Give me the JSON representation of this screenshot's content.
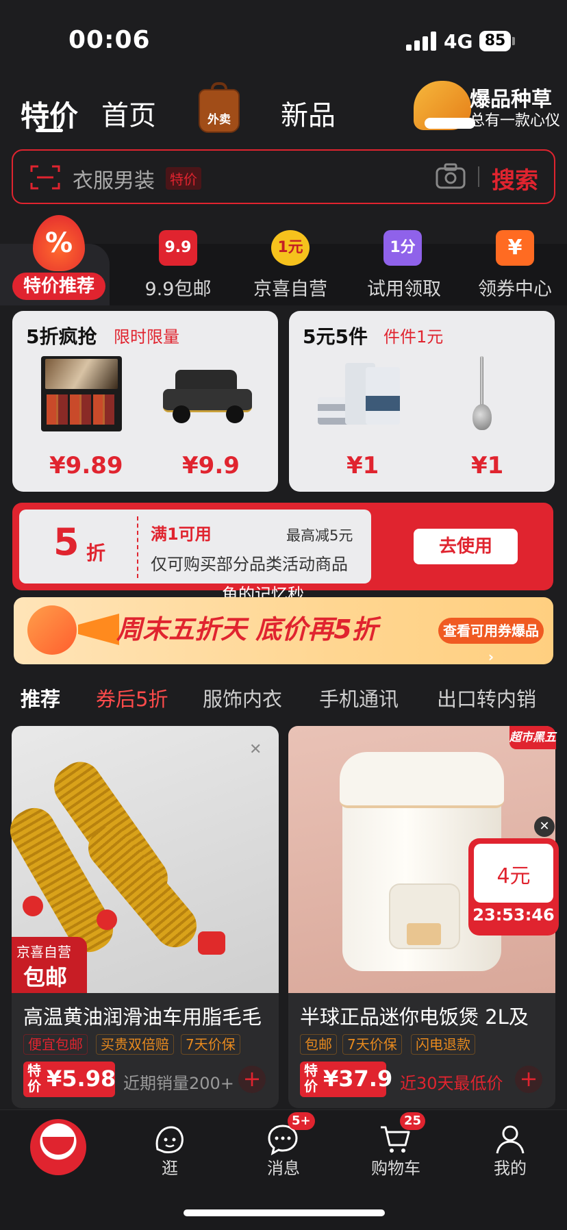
{
  "status_bar": {
    "time": "00:06",
    "network": "4G",
    "battery": "85"
  },
  "top_nav": {
    "tabs": [
      "特价",
      "首页",
      "新品"
    ],
    "takeout_label": "外卖",
    "promo_title": "爆品种草",
    "promo_subtitle": "总有一款心仪"
  },
  "search": {
    "placeholder": "衣服男装",
    "tag": "特价",
    "button": "搜索"
  },
  "categories": [
    {
      "label": "特价推荐",
      "icon": "flame-percent-icon",
      "icon_text": "%"
    },
    {
      "label": "9.9包邮",
      "icon": "bag-9.9-icon",
      "icon_text": "9.9"
    },
    {
      "label": "京喜自营",
      "icon": "badge-1yuan-icon",
      "icon_text": "1元"
    },
    {
      "label": "试用领取",
      "icon": "bag-1fen-icon",
      "icon_text": "1分"
    },
    {
      "label": "领券中心",
      "icon": "coupon-yen-icon",
      "icon_text": "¥"
    }
  ],
  "deals": [
    {
      "title": "5折疯抢",
      "subtitle": "限时限量",
      "prices": [
        "¥9.89",
        "¥9.9"
      ]
    },
    {
      "title": "5元5件",
      "subtitle": "件件1元",
      "prices": [
        "¥1",
        "¥1"
      ]
    }
  ],
  "coupon": {
    "discount": "5",
    "unit": "折",
    "condition": "满1可用",
    "max": "最高减5元",
    "desc": "仅可购买部分品类活动商品",
    "button": "去使用"
  },
  "watermark": "鱼的记忆秒",
  "banner": {
    "text": "周末五折天 底价再5折",
    "button": "查看可用券爆品 ›"
  },
  "feed_tabs": [
    "推荐",
    "券后5折",
    "服饰内衣",
    "手机通讯",
    "出口转内销"
  ],
  "products": [
    {
      "title": "高温黄油润滑油车用脂毛毛",
      "badge_top": "京喜自营",
      "badge_bottom": "包邮",
      "tags": [
        "便宜包邮",
        "买贵双倍赔",
        "7天价保"
      ],
      "price_label": "特价",
      "price": "¥5.98",
      "note": "近期销量200+"
    },
    {
      "title": "半球正品迷你电饭煲 2L及",
      "corner_tag": "超市黑五",
      "flash_price": "4元",
      "flash_timer": "23:53:46",
      "tags": [
        "包邮",
        "7天价保",
        "闪电退款"
      ],
      "price_label": "特价",
      "price": "¥37.9",
      "note": "近30天最低价"
    }
  ],
  "bottom_nav": [
    {
      "label": "逛",
      "icon": "face-icon"
    },
    {
      "label": "消息",
      "icon": "chat-icon",
      "badge": "5+"
    },
    {
      "label": "购物车",
      "icon": "cart-icon",
      "badge": "25"
    },
    {
      "label": "我的",
      "icon": "user-icon"
    }
  ]
}
